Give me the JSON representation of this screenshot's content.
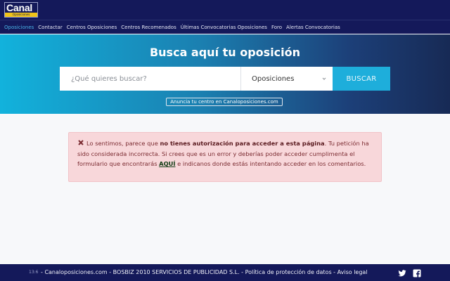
{
  "logo": {
    "name": "Canal",
    "sub": "Oposiciones"
  },
  "nav": {
    "items": [
      {
        "label": "Oposiciones",
        "active": true
      },
      {
        "label": "Contactar",
        "active": false
      },
      {
        "label": "Centros Oposiciones",
        "active": false
      },
      {
        "label": "Centros Recomenados",
        "active": false
      },
      {
        "label": "Últimas Convocatorias Oposiciones",
        "active": false
      },
      {
        "label": "Foro",
        "active": false
      },
      {
        "label": "Alertas Convocatorias",
        "active": false
      }
    ]
  },
  "hero": {
    "title": "Busca aquí tu oposición",
    "search_placeholder": "¿Qué quieres buscar?",
    "select_value": "Oposiciones",
    "button_label": "BUSCAR",
    "announce_label": "Anuncia tu centro en Canaloposiciones.com"
  },
  "alert": {
    "text_1": "Lo sentimos, parece que ",
    "bold": "no tienes autorización para acceder a esta página",
    "text_2": ". Tu petición ha sido considerada incorrecta. Si crees que es un error y deberías poder acceder cumplimenta el formulario que encontrarás ",
    "link": "AQUÍ",
    "text_3": " e indicanos donde estás intentando acceder en los comentarios."
  },
  "footer": {
    "time": "13:6",
    "site": "Canaloposiciones.com",
    "company": "BOSBIZ 2010 SERVICIOS DE PUBLICIDAD S.L.",
    "privacy": "Política de protección de datos",
    "legal": "Aviso legal",
    "separator": " - "
  },
  "icons": {
    "twitter": "twitter-icon",
    "facebook": "facebook-icon",
    "alert": "x-mark-icon",
    "select": "chevron-down-icon"
  },
  "colors": {
    "header_bg": "#14195a",
    "accent": "#1eaedb",
    "alert_bg": "#f8d7da",
    "alert_text": "#7a2a30"
  }
}
